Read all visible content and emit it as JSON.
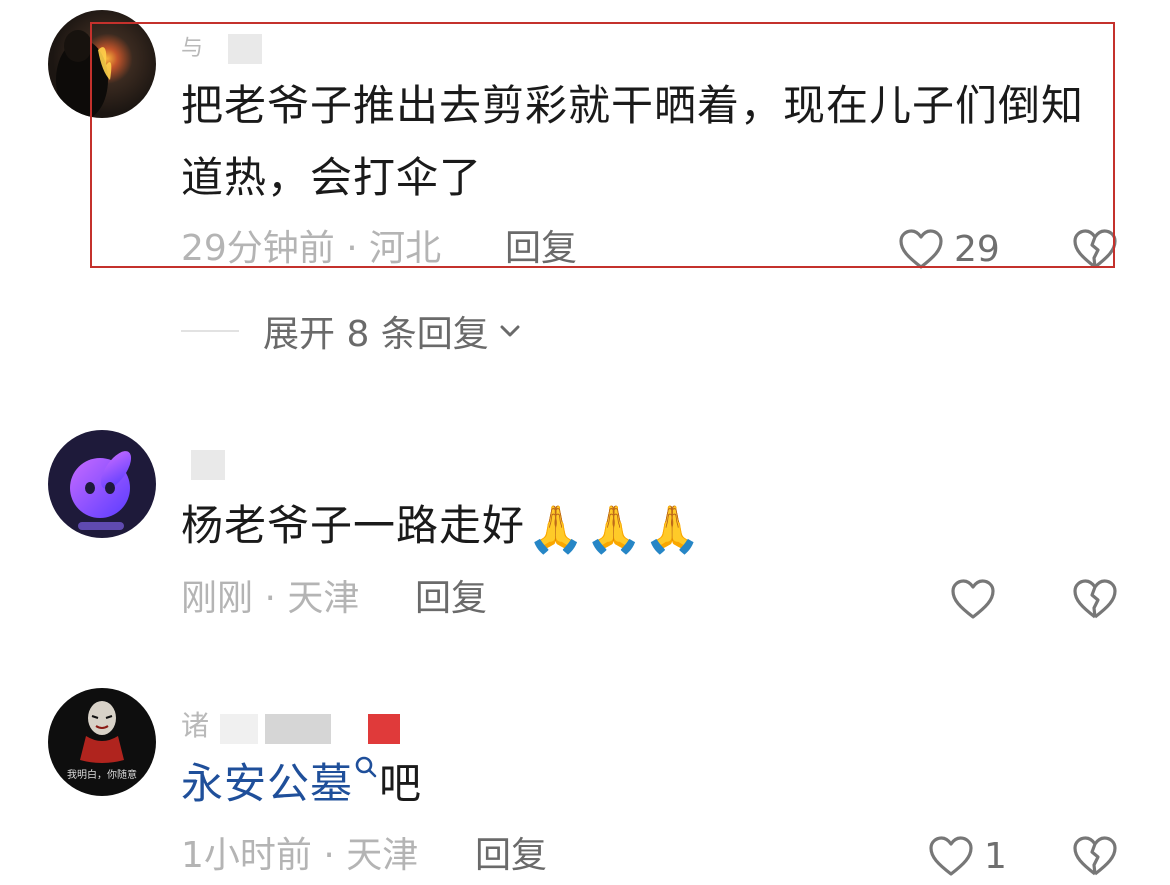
{
  "comments": [
    {
      "username_visible": "与",
      "text": "把老爷子推出去剪彩就干晒着，现在儿子们倒知道热，会打伞了",
      "time_location": "29分钟前 · 河北",
      "reply_label": "回复",
      "like_count": "29",
      "expand_label": "展开 8 条回复"
    },
    {
      "username_visible": "",
      "text": "杨老爷子一路走好",
      "emoji": "🙏🙏🙏",
      "time_location": "刚刚 · 天津",
      "reply_label": "回复",
      "like_count": ""
    },
    {
      "username_visible": "诸",
      "link_text": "永安公墓",
      "text_suffix": "吧",
      "time_location": "1小时前 · 天津",
      "reply_label": "回复",
      "like_count": "1",
      "avatar_caption": "我明白，你随意"
    }
  ],
  "icons": {
    "like": "heart-outline-icon",
    "dislike": "broken-heart-icon",
    "expand": "chevron-down-icon",
    "search": "search-icon"
  },
  "colors": {
    "highlight_border": "#c4312c",
    "link": "#1f4f9a",
    "meta": "#b4b4b4",
    "text": "#1a1a1a"
  }
}
